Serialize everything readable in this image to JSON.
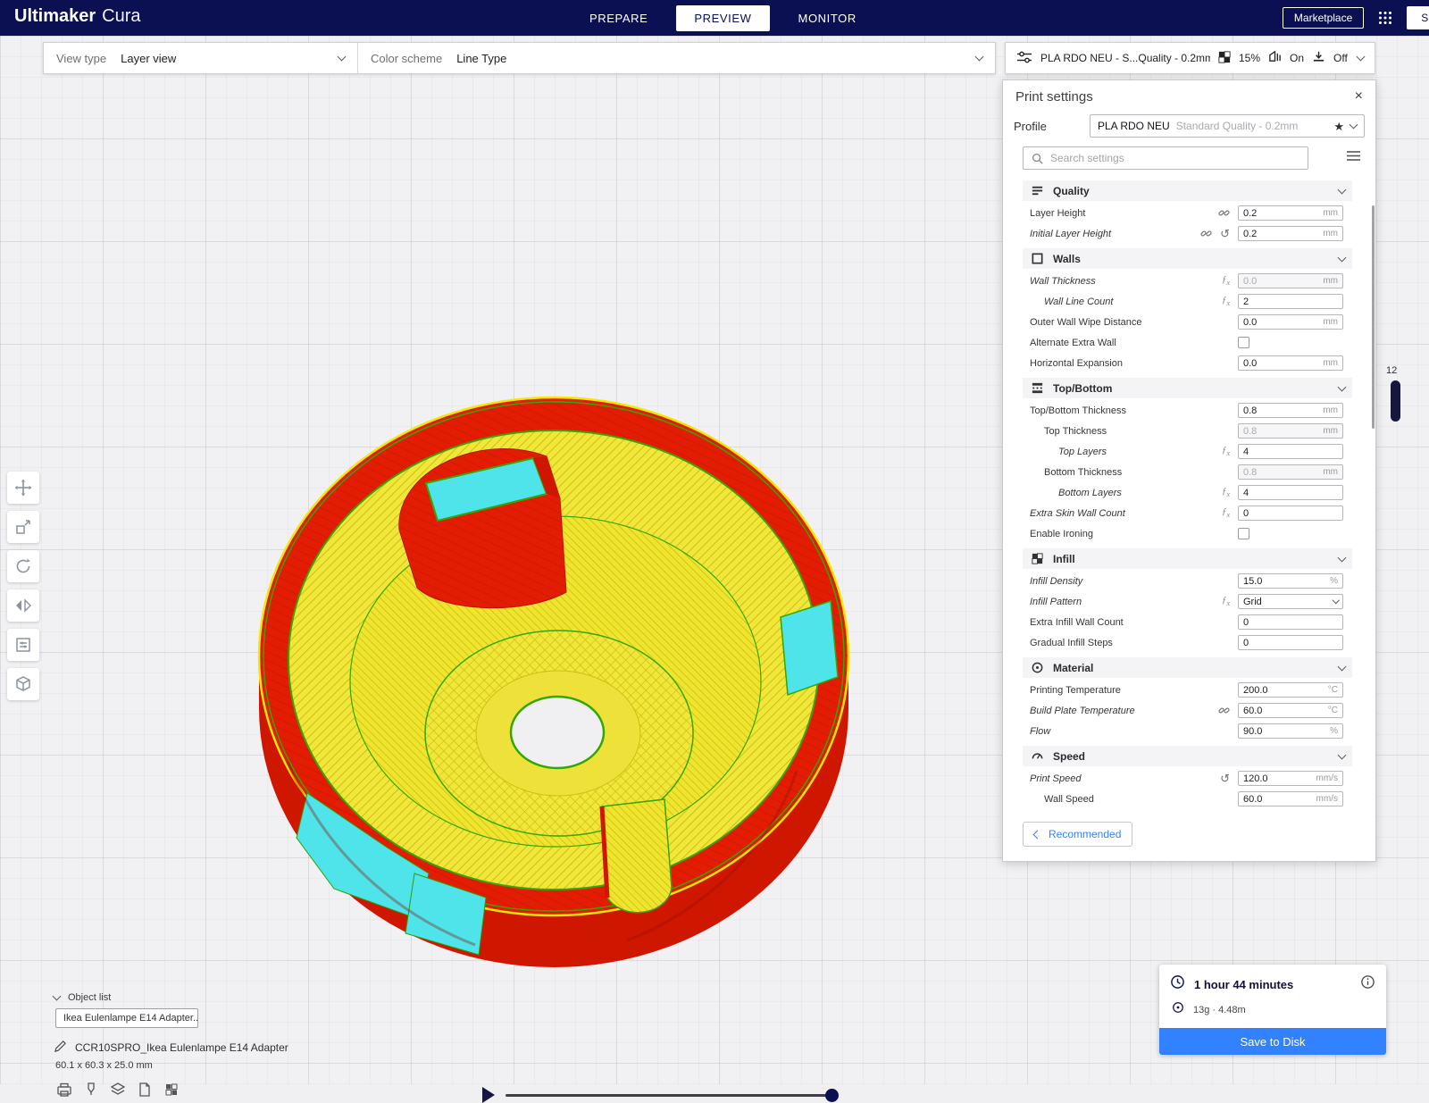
{
  "header": {
    "logo_bold": "Ultimaker",
    "logo_light": "Cura",
    "tabs": [
      {
        "label": "PREPARE"
      },
      {
        "label": "PREVIEW"
      },
      {
        "label": "MONITOR"
      }
    ],
    "marketplace_label": "Marketplace",
    "signin_label": "Sign in"
  },
  "subbar": {
    "view_type_label": "View type",
    "view_type_value": "Layer view",
    "color_scheme_label": "Color scheme",
    "color_scheme_value": "Line Type",
    "printer_bar": {
      "profile_summary": "PLA RDO NEU - S...Quality - 0.2mm",
      "infill_percent": "15%",
      "support_state": "On",
      "adhesion_state": "Off"
    }
  },
  "panel": {
    "title": "Print settings",
    "profile_label": "Profile",
    "profile_value": "PLA RDO NEU",
    "profile_quality": "Standard Quality - 0.2mm",
    "search_placeholder": "Search settings",
    "recommended_label": "Recommended",
    "sections": [
      {
        "name": "quality",
        "label": "Quality",
        "icon": "quality-icon",
        "rows": [
          {
            "label": "Layer Height",
            "value": "0.2",
            "unit": "mm",
            "icons": [
              "link"
            ]
          },
          {
            "label": "Initial Layer Height",
            "value": "0.2",
            "unit": "mm",
            "icons": [
              "link",
              "revert"
            ],
            "italic": true
          }
        ]
      },
      {
        "name": "walls",
        "label": "Walls",
        "icon": "walls-icon",
        "rows": [
          {
            "label": "Wall Thickness",
            "value": "0.0",
            "unit": "mm",
            "icons": [
              "fx"
            ],
            "italic": true,
            "disabled": true
          },
          {
            "label": "Wall Line Count",
            "value": "2",
            "icons": [
              "fx"
            ],
            "italic": true,
            "indent": 1
          },
          {
            "label": "Outer Wall Wipe Distance",
            "value": "0.0",
            "unit": "mm"
          },
          {
            "label": "Alternate Extra Wall",
            "checkbox": true
          },
          {
            "label": "Horizontal Expansion",
            "value": "0.0",
            "unit": "mm"
          }
        ]
      },
      {
        "name": "topbottom",
        "label": "Top/Bottom",
        "icon": "topbottom-icon",
        "rows": [
          {
            "label": "Top/Bottom Thickness",
            "value": "0.8",
            "unit": "mm"
          },
          {
            "label": "Top Thickness",
            "value": "0.8",
            "unit": "mm",
            "indent": 1,
            "disabled": true
          },
          {
            "label": "Top Layers",
            "value": "4",
            "icons": [
              "fx"
            ],
            "italic": true,
            "indent": 2
          },
          {
            "label": "Bottom Thickness",
            "value": "0.8",
            "unit": "mm",
            "indent": 1,
            "disabled": true
          },
          {
            "label": "Bottom Layers",
            "value": "4",
            "icons": [
              "fx"
            ],
            "italic": true,
            "indent": 2
          },
          {
            "label": "Extra Skin Wall Count",
            "value": "0",
            "icons": [
              "fx"
            ],
            "italic": true
          },
          {
            "label": "Enable Ironing",
            "checkbox": true
          }
        ]
      },
      {
        "name": "infill",
        "label": "Infill",
        "icon": "infill-icon",
        "rows": [
          {
            "label": "Infill Density",
            "value": "15.0",
            "unit": "%",
            "italic": true
          },
          {
            "label": "Infill Pattern",
            "value": "Grid",
            "dropdown": true,
            "icons": [
              "fx"
            ],
            "italic": true
          },
          {
            "label": "Extra Infill Wall Count",
            "value": "0"
          },
          {
            "label": "Gradual Infill Steps",
            "value": "0"
          }
        ]
      },
      {
        "name": "material",
        "label": "Material",
        "icon": "material-icon",
        "rows": [
          {
            "label": "Printing Temperature",
            "value": "200.0",
            "unit": "°C"
          },
          {
            "label": "Build Plate Temperature",
            "value": "60.0",
            "unit": "°C",
            "icons": [
              "link"
            ],
            "italic": true
          },
          {
            "label": "Flow",
            "value": "90.0",
            "unit": "%",
            "italic": true
          }
        ]
      },
      {
        "name": "speed",
        "label": "Speed",
        "icon": "speed-icon",
        "rows": [
          {
            "label": "Print Speed",
            "value": "120.0",
            "unit": "mm/s",
            "icons": [
              "revert"
            ],
            "italic": true
          },
          {
            "label": "Wall Speed",
            "value": "60.0",
            "unit": "mm/s",
            "indent": 1
          }
        ]
      }
    ]
  },
  "viewport": {
    "object_list_label": "Object list",
    "object_chip": "Ikea Eulenlampe E14 Adapter...",
    "project_name": "CCR10SPRO_Ikea Eulenlampe E14 Adapter",
    "dimensions": "60.1 x 60.3 x 25.0 mm",
    "layer_indicator": "12"
  },
  "summary": {
    "time": "1 hour 44 minutes",
    "material": "13g · 4.48m",
    "save_label": "Save to Disk"
  },
  "icons": {
    "close": "×",
    "star": "★",
    "revert": "↺"
  },
  "colors": {
    "accent_blue": "#3282ff",
    "header_navy": "#0b1052",
    "model_red": "#e31d03",
    "model_yellow": "#f0e73a",
    "model_cyan": "#4fe3ea",
    "model_green": "#35a702"
  }
}
